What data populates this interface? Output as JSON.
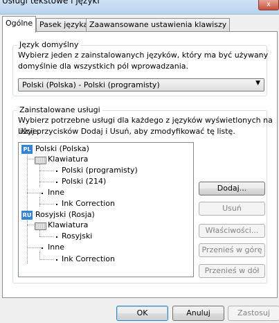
{
  "window": {
    "title": "Usługi tekstowe i języki",
    "close_glyph": "x"
  },
  "tabs": [
    {
      "label": "Ogólne",
      "active": true
    },
    {
      "label": "Pasek języka",
      "active": false
    },
    {
      "label": "Zaawansowane ustawienia klawiszy",
      "active": false
    }
  ],
  "default_language": {
    "group_title": "Język domyślny",
    "description_line1": "Wybierz jeden z zainstalowanych języków, który ma być używany",
    "description_line2": "domyślnie dla wszystkich pól wprowadzania.",
    "selected_value": "Polski (Polska) - Polski (programisty)"
  },
  "installed_services": {
    "group_title": "Zainstalowane usługi",
    "description_line1": "Wybierz potrzebne usługi dla każdego z języków wyświetlonych na liście.",
    "description_line2": "Użyj przycisków Dodaj i Usuń, aby zmodyfikować tę listę.",
    "tree": {
      "lang1_badge": "PL",
      "lang1_label": "Polski (Polska)",
      "lang1_keyboard": "Klawiatura",
      "lang1_kb1": "Polski (programisty)",
      "lang1_kb2": "Polski (214)",
      "lang1_other": "Inne",
      "lang1_ink": "Ink Correction",
      "lang2_badge": "RU",
      "lang2_label": "Rosyjski (Rosja)",
      "lang2_keyboard": "Klawiatura",
      "lang2_kb1": "Rosyjski",
      "lang2_other": "Inne",
      "lang2_ink": "Ink Correction"
    },
    "buttons": {
      "add": "Dodaj...",
      "remove": "Usuń",
      "properties": "Właściwości...",
      "move_up": "Przenieś w górę",
      "move_down": "Przenieś w dół"
    }
  },
  "footer": {
    "ok": "OK",
    "cancel": "Anuluj",
    "apply": "Zastosuj"
  },
  "colors": {
    "lang_badge": "#3583d6",
    "tab_border": "#8e8f8f"
  }
}
